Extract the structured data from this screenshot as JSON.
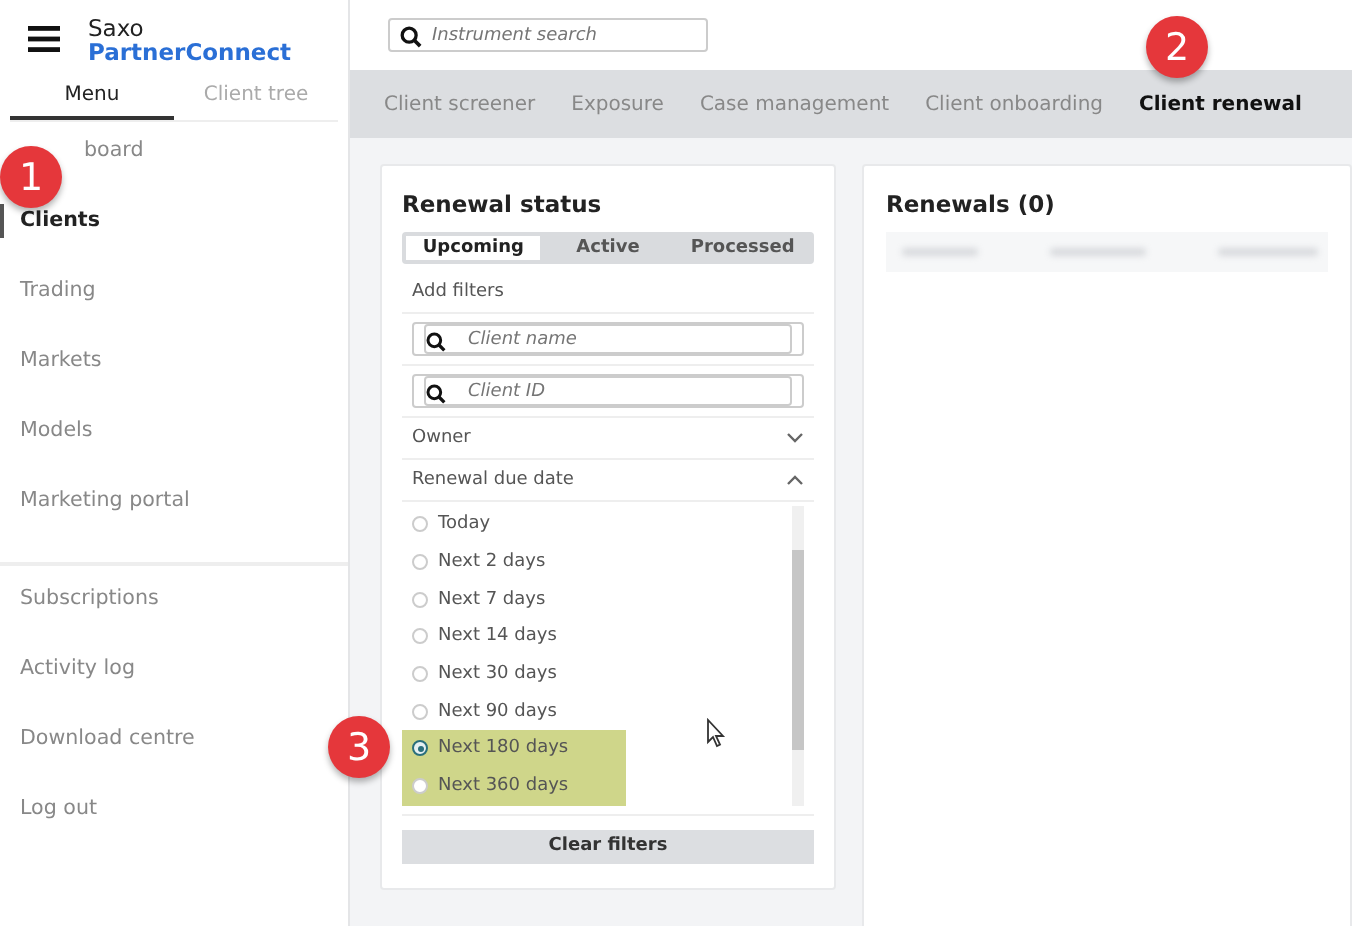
{
  "brand": {
    "line1": "Saxo",
    "line2": "PartnerConnect"
  },
  "sidebar_tabs": [
    {
      "label": "Menu",
      "selected": true
    },
    {
      "label": "Client tree",
      "selected": false
    }
  ],
  "sidebar": {
    "items": [
      {
        "label": "board",
        "selected": false
      },
      {
        "label": "Clients",
        "selected": true
      },
      {
        "label": "Trading",
        "selected": false
      },
      {
        "label": "Markets",
        "selected": false
      },
      {
        "label": "Models",
        "selected": false
      },
      {
        "label": "Marketing portal",
        "selected": false
      }
    ],
    "secondary_items": [
      {
        "label": "Subscriptions"
      },
      {
        "label": "Activity log"
      },
      {
        "label": "Download centre"
      },
      {
        "label": "Log out"
      }
    ]
  },
  "search": {
    "placeholder": "Instrument search"
  },
  "tabs": [
    {
      "label": "Client screener",
      "selected": false
    },
    {
      "label": "Exposure",
      "selected": false
    },
    {
      "label": "Case management",
      "selected": false
    },
    {
      "label": "Client onboarding",
      "selected": false
    },
    {
      "label": "Client renewal",
      "selected": true
    }
  ],
  "renewal_status": {
    "title": "Renewal status",
    "segments": [
      {
        "label": "Upcoming",
        "selected": true
      },
      {
        "label": "Active",
        "selected": false
      },
      {
        "label": "Processed",
        "selected": false
      }
    ],
    "add_filters": "Add filters",
    "fields": [
      {
        "placeholder": "Client name"
      },
      {
        "placeholder": "Client ID"
      }
    ],
    "sections": [
      {
        "label": "Owner",
        "expanded": false
      },
      {
        "label": "Renewal due date",
        "expanded": true
      }
    ],
    "options": [
      {
        "label": "Today",
        "selected": false,
        "highlighted": false
      },
      {
        "label": "Next 2 days",
        "selected": false,
        "highlighted": false
      },
      {
        "label": "Next 7 days",
        "selected": false,
        "highlighted": false
      },
      {
        "label": "Next 14 days",
        "selected": false,
        "highlighted": false
      },
      {
        "label": "Next 30 days",
        "selected": false,
        "highlighted": false
      },
      {
        "label": "Next 90 days",
        "selected": false,
        "highlighted": false
      },
      {
        "label": "Next 180 days",
        "selected": true,
        "highlighted": true
      },
      {
        "label": "Next 360 days",
        "selected": false,
        "highlighted": true
      }
    ],
    "clear_button": "Clear filters"
  },
  "renewals": {
    "title": "Renewals (0)"
  },
  "annotations": [
    {
      "label": "1"
    },
    {
      "label": "2"
    },
    {
      "label": "3"
    }
  ]
}
